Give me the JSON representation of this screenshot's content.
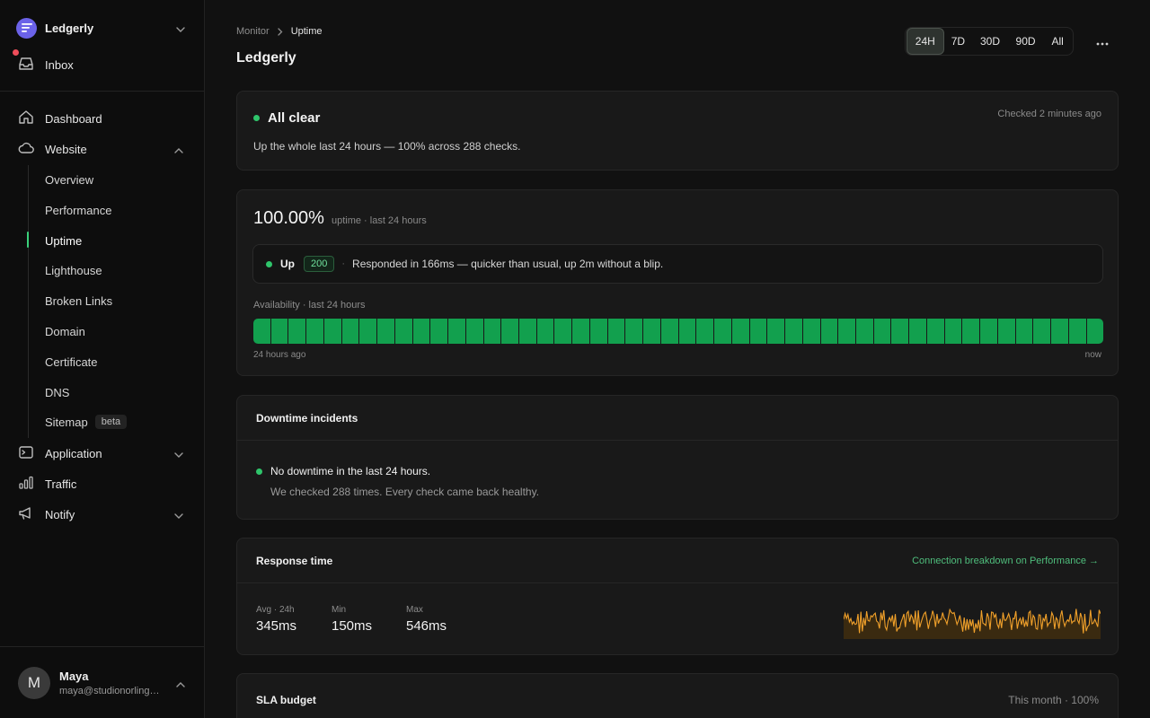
{
  "workspace": {
    "name": "Ledgerly",
    "icon": "list-lines-icon"
  },
  "inbox": {
    "label": "Inbox",
    "has_notification": true
  },
  "sidebar": {
    "items": [
      {
        "label": "Dashboard",
        "icon": "home-icon"
      },
      {
        "label": "Website",
        "icon": "cloud-icon",
        "expanded": true
      },
      {
        "label": "Application",
        "icon": "terminal-icon",
        "expanded": false
      },
      {
        "label": "Traffic",
        "icon": "bar-chart-icon"
      },
      {
        "label": "Notify",
        "icon": "megaphone-icon",
        "expanded": false
      }
    ],
    "website_sub": [
      {
        "label": "Overview"
      },
      {
        "label": "Performance"
      },
      {
        "label": "Uptime",
        "active": true
      },
      {
        "label": "Lighthouse"
      },
      {
        "label": "Broken Links"
      },
      {
        "label": "Domain"
      },
      {
        "label": "Certificate"
      },
      {
        "label": "DNS"
      },
      {
        "label": "Sitemap",
        "badge": "beta"
      }
    ]
  },
  "user": {
    "initial": "M",
    "name": "Maya",
    "email": "maya@studionorling.c..."
  },
  "breadcrumb": {
    "parent": "Monitor",
    "current": "Uptime"
  },
  "page": {
    "title": "Ledgerly"
  },
  "range": {
    "options": [
      "24H",
      "7D",
      "30D",
      "90D",
      "All"
    ],
    "selected": "24H"
  },
  "status_card": {
    "title": "All clear",
    "checked": "Checked 2 minutes ago",
    "description": "Up the whole last 24 hours — 100% across 288 checks."
  },
  "uptime_card": {
    "percent": "100.00%",
    "percent_label": "uptime · last 24 hours",
    "state": "Up",
    "code": "200",
    "message": "Responded in 166ms — quicker than usual, up 2m without a blip.",
    "availability_label": "Availability · last 24 hours",
    "segments": 48,
    "availability_fraction": 1.0,
    "start_label": "24 hours ago",
    "end_label": "now"
  },
  "incidents": {
    "title": "Downtime incidents",
    "headline": "No downtime in the last 24 hours.",
    "detail": "We checked 288 times. Every check came back healthy."
  },
  "response": {
    "title": "Response time",
    "link": "Connection breakdown on Performance →",
    "metrics": [
      {
        "label": "Avg · 24h",
        "value": "345ms"
      },
      {
        "label": "Min",
        "value": "150ms"
      },
      {
        "label": "Max",
        "value": "546ms"
      }
    ],
    "sparkline_color": "#f0a02a"
  },
  "sla": {
    "title": "SLA budget",
    "right": "This month · 100%"
  },
  "colors": {
    "accent_green": "#2fc56b",
    "bar_green": "#12a04e",
    "alert_red": "#ef4d5a",
    "brand_purple": "#6b62e8"
  }
}
